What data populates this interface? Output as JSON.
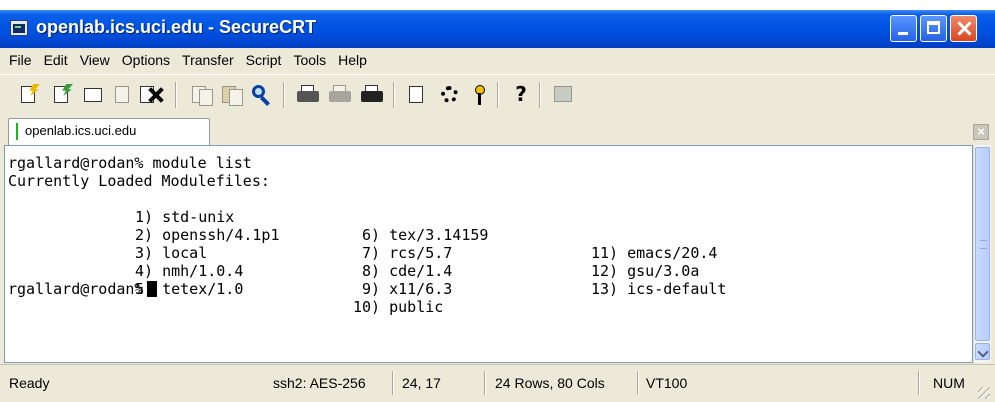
{
  "window": {
    "title": "openlab.ics.uci.edu - SecureCRT"
  },
  "menu": [
    "File",
    "Edit",
    "View",
    "Options",
    "Transfer",
    "Script",
    "Tools",
    "Help"
  ],
  "toolbar": {
    "icons": [
      "connect-icon",
      "quick-connect-icon",
      "connect-in-tab-icon",
      "reconnect-icon",
      "disconnect-icon",
      "copy-icon",
      "paste-icon",
      "find-icon",
      "print-icon",
      "print-selection-icon",
      "print-setup-icon",
      "session-options-icon",
      "global-options-icon",
      "keymap-icon",
      "help-icon",
      "sftp-icon"
    ]
  },
  "tab": {
    "label": "openlab.ics.uci.edu",
    "close": "×"
  },
  "terminal": {
    "prompt_command": "rgallard@rodan% module list",
    "header": "Currently Loaded Modulefiles:",
    "rows": [
      [
        "1) std-unix",
        "6) tex/3.14159",
        "11) emacs/20.4"
      ],
      [
        "2) openssh/4.1p1",
        "7) rcs/5.7",
        "12) gsu/3.0a"
      ],
      [
        "3) local",
        "8) cde/1.4",
        "13) ics-default"
      ],
      [
        "4) nmh/1.0.4",
        "9) x11/6.3",
        ""
      ],
      [
        "5) tetex/1.0",
        "10) public",
        ""
      ]
    ],
    "prompt": "rgallard@rodan%"
  },
  "status": {
    "state": "Ready",
    "cipher": "ssh2: AES-256",
    "cursor_pos": "24, 17",
    "size": "24 Rows, 80 Cols",
    "emulation": "VT100",
    "num": "NUM"
  },
  "colors": {
    "titlebar": "#0054e3",
    "chrome": "#ece9d8",
    "terminal_bg": "#ffffff",
    "terminal_fg": "#000000"
  }
}
